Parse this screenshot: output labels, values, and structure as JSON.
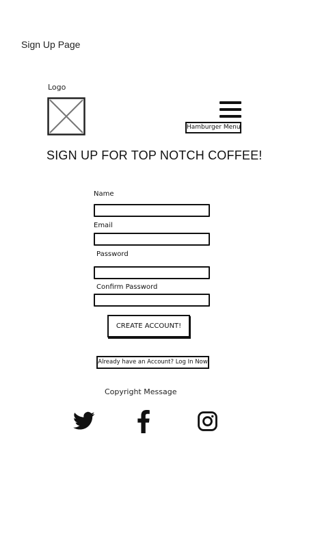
{
  "page_caption": "Sign Up Page",
  "header": {
    "logo_label": "Logo",
    "menu_label": "Hamburger Menu"
  },
  "title": "SIGN UP FOR TOP NOTCH COFFEE!",
  "form": {
    "fields": [
      {
        "label": "Name",
        "value": ""
      },
      {
        "label": "Email",
        "value": ""
      },
      {
        "label": "Password",
        "value": ""
      },
      {
        "label": "Confirm Password",
        "value": ""
      }
    ],
    "submit_label": "CREATE ACCOUNT!",
    "login_link": "Already have an Account? Log In Now"
  },
  "footer": {
    "copyright": "Copyright Message",
    "social_icons": [
      "twitter-icon",
      "facebook-icon",
      "instagram-icon"
    ]
  }
}
